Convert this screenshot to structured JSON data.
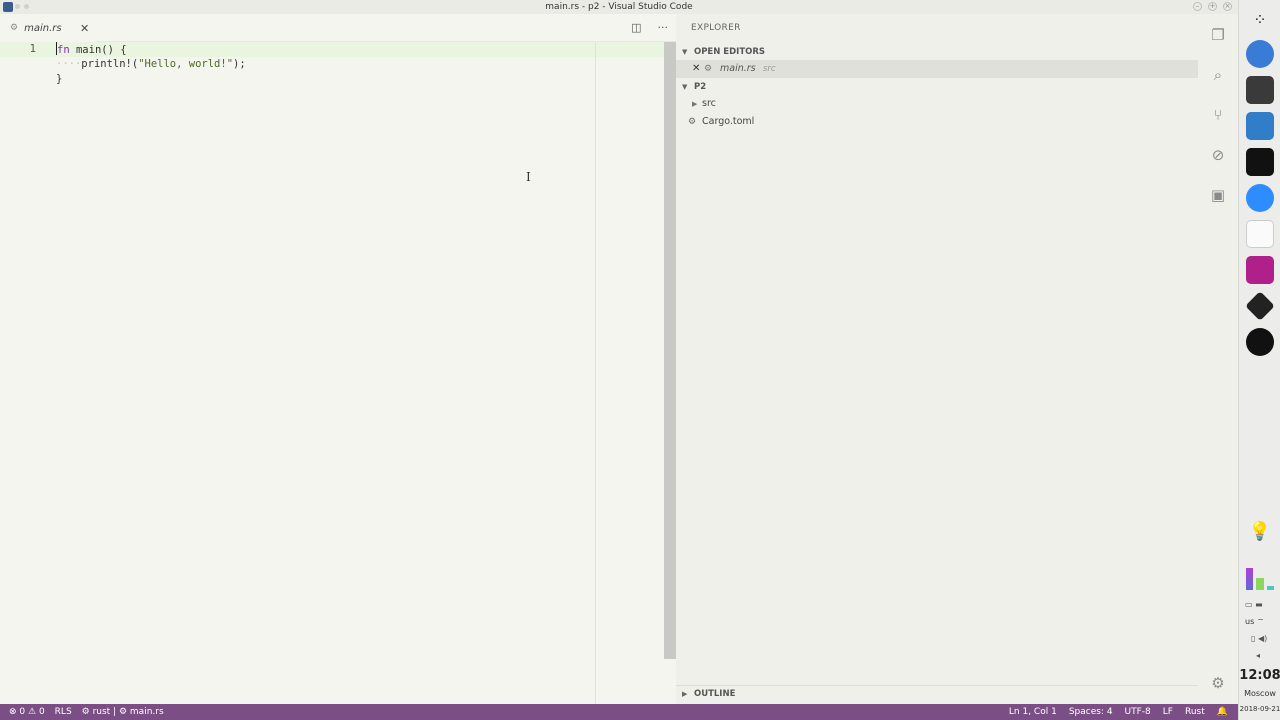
{
  "window": {
    "title": "main.rs - p2 - Visual Studio Code"
  },
  "tab": {
    "label": "main.rs"
  },
  "editor": {
    "lines": [
      {
        "num": "1",
        "kw": "fn",
        "rest": " main() {"
      },
      {
        "num": "",
        "macro": "println!(",
        "str": "\"Hello, world!\"",
        "tail": ");"
      },
      {
        "num": "",
        "text": "}"
      }
    ]
  },
  "explorer": {
    "title": "EXPLORER",
    "open_editors": "OPEN EDITORS",
    "open_file": "main.rs",
    "open_file_dir": "src",
    "project": "P2",
    "tree": [
      {
        "label": "src"
      },
      {
        "label": "Cargo.toml"
      }
    ],
    "outline": "OUTLINE"
  },
  "status": {
    "errors": "0",
    "warnings": "0",
    "rls": "RLS",
    "toolchain": "rust",
    "file": "main.rs",
    "position": "Ln 1, Col 1",
    "spaces": "Spaces: 4",
    "encoding": "UTF-8",
    "eol": "LF",
    "language": "Rust"
  },
  "dock": {
    "kbd_layout": "us",
    "time": "12:08",
    "city": "Moscow",
    "date": "2018-09-21"
  },
  "colors": {
    "accent_status": "#7b4f86",
    "keyword": "#8a2bb2"
  }
}
